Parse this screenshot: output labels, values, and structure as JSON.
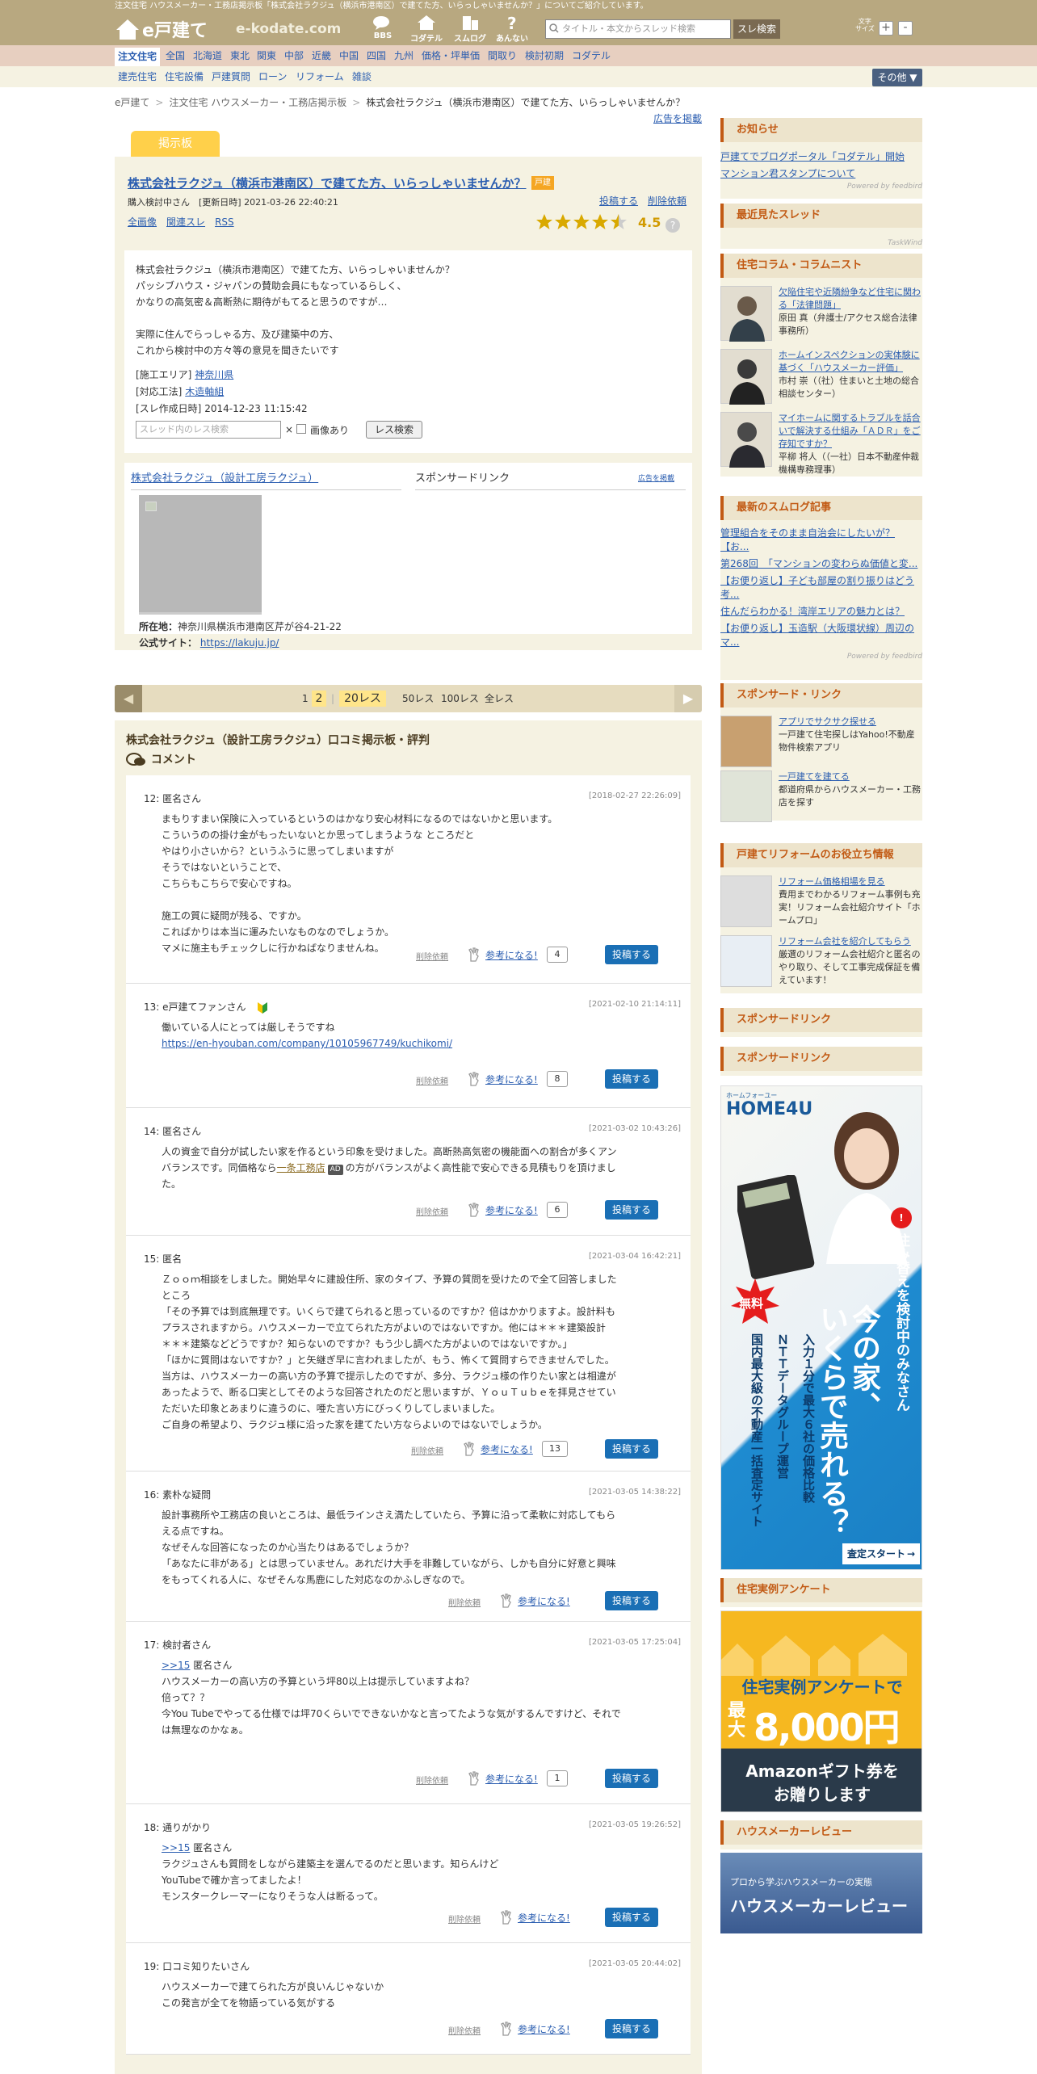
{
  "top_strip": "注文住宅 ハウスメーカー・工務店掲示板「株式会社ラクジュ（横浜市港南区）で建てた方、いらっしゃいませんか？」についてご紹介しています。",
  "header": {
    "logo": "e戸建て",
    "logo_domain": "e-kodate.com",
    "nav": [
      {
        "label": "BBS",
        "icon": "bbs-icon"
      },
      {
        "label": "コダテル",
        "icon": "house-icon"
      },
      {
        "label": "スムログ",
        "icon": "building-icon"
      },
      {
        "label": "あんない",
        "icon": "question-icon"
      }
    ],
    "search_placeholder": "タイトル・本文からスレッド検索",
    "search_button": "スレ検索",
    "font_size_label": "文字\nサイズ",
    "font_plus": "+",
    "font_minus": "-"
  },
  "regions": [
    "注文住宅",
    "全国",
    "北海道",
    "東北",
    "関東",
    "中部",
    "近畿",
    "中国",
    "四国",
    "九州",
    "価格・坪単価",
    "間取り",
    "検討初期",
    "コダテル"
  ],
  "subnav": [
    "建売住宅",
    "住宅設備",
    "戸建質問",
    "ローン",
    "リフォーム",
    "雑談"
  ],
  "other_button": "その他 ▼",
  "breadcrumb": [
    "e戸建て",
    "注文住宅 ハウスメーカー・工務店掲示板",
    "株式会社ラクジュ（横浜市港南区）で建てた方、いらっしゃいませんか？"
  ],
  "ad_report": "広告を掲載",
  "tab_label": "掲示板",
  "thread": {
    "title": "株式会社ラクジュ（横浜市港南区）で建てた方、いらっしゃいませんか？",
    "badge": "戸建",
    "author": "購入検討中さん",
    "updated": "[更新日時] 2021-03-26 22:40:21",
    "post_link": "投稿する",
    "delete_link": "削除依頼",
    "links": [
      "全画像",
      "関連スレ",
      "RSS"
    ],
    "rating": "4.5",
    "help": "?",
    "body": [
      "株式会社ラクジュ（横浜市港南区）で建てた方、いらっしゃいませんか？",
      "パッシブハウス・ジャパンの賛助会員にもなっているらしく、",
      "かなりの高気密＆高断熱に期待がもてると思うのですが…",
      "",
      "実際に住んでらっしゃる方、及び建築中の方、",
      "これから検討中の方々等の意見を聞きたいです"
    ],
    "area_label": "[施工エリア]",
    "area": "神奈川県",
    "method_label": "[対応工法]",
    "method": "木造軸組",
    "created_label": "[スレ作成日時]",
    "created": "2014-12-23 11:15:42",
    "search_placeholder": "スレッド内のレス検索",
    "search_x": "×",
    "image_only": "画像あり",
    "search_button": "レス検索"
  },
  "corp": {
    "name": "株式会社ラクジュ（設計工房ラクジュ）",
    "sponsor": "スポンサードリンク",
    "sponsor_link": "広告を掲載",
    "addr_label": "所在地：",
    "addr": "神奈川県横浜市港南区芹が谷4-21-22",
    "site_label": "公式サイト：",
    "site": "https://lakuju.jp/"
  },
  "pager": {
    "pages": [
      "1",
      "2"
    ],
    "current": "20レス",
    "options": [
      "50レス",
      "100レス",
      "全レス"
    ],
    "prev": "◀",
    "next": "▶"
  },
  "comments_title": "株式会社ラクジュ（設計工房ラクジュ）口コミ掲示板・評判",
  "comments_sub": "コメント",
  "post_actions": {
    "delete": "削除依頼",
    "helpful": "参考になる!",
    "post": "投稿する"
  },
  "posts": [
    {
      "name": "12: 匿名さん",
      "date": "[2018-02-27 22:26:09]",
      "lines": [
        "まもりすまい保険に入っているというのはかなり安心材料になるのではないかと思います。",
        "こういうのの掛け金がもったいないとか思ってしまうような ところだと",
        "やはり小さいから？というふうに思ってしまいますが",
        "そうではないということで、",
        "こちらもこちらで安心ですね。",
        "",
        "施工の質に疑問が残る、ですか。",
        "こればかりは本当に運みたいなものなのでしょうか。",
        "マメに施主もチェックしに行かねばなりませんね。"
      ],
      "count": "4"
    },
    {
      "name": "13: e戸建てファンさん",
      "date": "[2021-02-10 21:14:11]",
      "lines": [
        "働いている人にとっては厳しそうですね"
      ],
      "link": "https://en-hyouban.com/company/10105967749/kuchikomi/",
      "count": "8"
    },
    {
      "name": "14: 匿名さん",
      "date": "[2021-03-02 10:43:26]",
      "lines": [
        "人の資金で自分が試したい家を作るという印象を受けました。高断熱高気密の機能面への割合が多くアン",
        "バランスです。同価格なら"
      ],
      "inline_link": "一条工務店",
      "ad_badge": "AD",
      "line_tail": "の方がバランスがよく高性能で安心できる見積もりを頂けまし",
      "last_line": "た。",
      "count": "6"
    },
    {
      "name": "15: 匿名",
      "date": "[2021-03-04 16:42:21]",
      "lines": [
        "Ｚｏｏｍ相談をしました。開始早々に建設住所、家のタイプ、予算の質問を受けたので全て回答しました",
        "ところ",
        "「その予算では到底無理です。いくらで建てられると思っているのですか？倍はかかりますよ。設計料も",
        "プラスされますから。ハウスメーカーで立てられた方がよいのではないですか。他には＊＊＊建築設計",
        "＊＊＊建築などどうですか？知らないのですか？もう少し調べた方がよいのではないですか。」",
        "「ほかに質問はないですか？」と矢継ぎ早に言われましたが、もう、怖くて質問すらできませんでした。",
        "当方は、ハウスメーカーの高い方の予算で提示したのですが、多分、ラクジュ様の作りたい家とは相違が",
        "あったようで、断る口実としてそのような回答されたのだと思いますが、ＹｏｕＴｕｂｅを拝見させてい",
        "ただいた印象とあまりに違うのに、唖た言い方にびっくりしてしまいました。",
        "ご自身の希望より、ラクジュ様に沿った家を建てたい方ならよいのではないでしょうか。"
      ],
      "count": "13"
    },
    {
      "name": "16: 素朴な疑問",
      "date": "[2021-03-05 14:38:22]",
      "lines": [
        "設計事務所や工務店の良いところは、最低ラインさえ満たしていたら、予算に沿って柔軟に対応してもら",
        "える点ですね。",
        "なぜそんな回答になったのか心当たりはあるでしょうか？",
        "「あなたに非がある」とは思っていません。あれだけ大手を非難していながら、しかも自分に好意と興味",
        "をもってくれる人に、なぜそんな馬鹿にした対応なのかふしぎなので。"
      ]
    },
    {
      "name": "17: 検討者さん",
      "date": "[2021-03-05 17:25:04]",
      "reply": ">>15",
      "lines": [
        "匿名さん",
        "ハウスメーカーの高い方の予算という坪80以上は提示していますよね？",
        "倍って？？",
        "今You Tubeでやってる仕様では坪70くらいでできないかなと言ってたような気がするんですけど、それで",
        "は無理なのかなぁ。"
      ],
      "count": "1"
    },
    {
      "name": "18: 通りがかり",
      "date": "[2021-03-05 19:26:52]",
      "reply": ">>15",
      "lines": [
        "匿名さん",
        "ラクジュさんも質問をしながら建築主を選んでるのだと思います。知らんけど",
        "YouTubeで確か言ってましたよ！",
        "モンスタークレーマーになりそうな人は断るって。"
      ]
    },
    {
      "name": "19: 口コミ知りたいさん",
      "date": "[2021-03-05 20:44:02]",
      "lines": [
        "ハウスメーカーで建てられた方が良いんじゃないか",
        "この発言が全てを物語っている気がする"
      ]
    }
  ],
  "side": {
    "news_title": "お知らせ",
    "news": [
      "戸建てでブログポータル「コダテル」開始",
      "マンション君スタンプについて"
    ],
    "powered": "Powered by feedbird",
    "recent_title": "最近見たスレッド",
    "column_title": "住宅コラム・コラムニスト",
    "columns": [
      {
        "link": "欠陥住宅や近隣紛争など住宅に関わる「法律問題」",
        "author": "原田 真（弁護士/アクセス総合法律事務所）",
        "icon": "person-icon"
      },
      {
        "link": "ホームインスペクションの実体験に基づく「ハウスメーカー評価」",
        "author": "市村 崇（（社）住まいと土地の総合相談センター）",
        "icon": "person-icon"
      },
      {
        "link": "マイホームに関するトラブルを話合いで解決する仕組み「ＡＤＲ」をご存知ですか？",
        "author": "平柳 将人（（一社）日本不動産仲裁機構専務理事）",
        "icon": "person-icon"
      }
    ],
    "smolog_title": "最新のスムログ記事",
    "smolog": [
      "管理組合をそのまま自治会にしたいが？【お...",
      "第268回　「マンションの変わらぬ価値と変...",
      "【お便り返し】子ども部屋の割り振りはどう考...",
      "住んだらわかる！湾岸エリアの魅力とは？",
      "【お便り返し】玉造駅（大阪環状線）周辺のマ..."
    ],
    "sponsor_title": "スポンサード・リンク",
    "sponsors": [
      {
        "link": "アプリでサクサク探せる",
        "text": "一戸建て住宅探しはYahoo!不動産物件検索アプリ"
      },
      {
        "link": "一戸建てを建てる",
        "text": "都道府県からハウスメーカー・工務店を探す"
      }
    ],
    "reform_title": "戸建てリフォームのお役立ち情報",
    "reforms": [
      {
        "link": "リフォーム価格相場を見る",
        "text": "費用までわかるリフォーム事例も充実！リフォーム会社紹介サイト「ホームプロ」"
      },
      {
        "link": "リフォーム会社を紹介してもらう",
        "text": "厳選のリフォーム会社紹介と匿名のやり取り、そして工事完成保証を備えています！"
      }
    ],
    "sponsored_title1": "スポンサードリンク",
    "sponsored_title2": "スポンサードリンク",
    "home4u": {
      "brand": "ホームフォーユー",
      "logo": "HOME4U",
      "badge": "無料",
      "headline_lines": [
        "今の家、",
        "いくらで売れる？"
      ],
      "side_text": "住み替えを検討中のみなさん",
      "points": [
        "入力１分で最大６社の価格比較",
        "ＮＴＴデータグループ運営",
        "国内最大級の不動産一括査定サイト"
      ],
      "cta": "査定スタート"
    },
    "survey_title": "住宅実例アンケート",
    "survey": {
      "line1": "住宅実例アンケートで",
      "line2": "最大",
      "amount": "8,000円",
      "gift1": "Amazonギフト券を",
      "gift2": "お贈りします"
    },
    "review_title": "ハウスメーカーレビュー",
    "review": {
      "small": "プロから学ぶハウスメーカーの実態",
      "big": "ハウスメーカーレビュー"
    },
    "colors": {
      "accent": "#c25a14",
      "link": "#2a5db0",
      "header": "#b8a880",
      "button": "#1a6fb5"
    }
  }
}
